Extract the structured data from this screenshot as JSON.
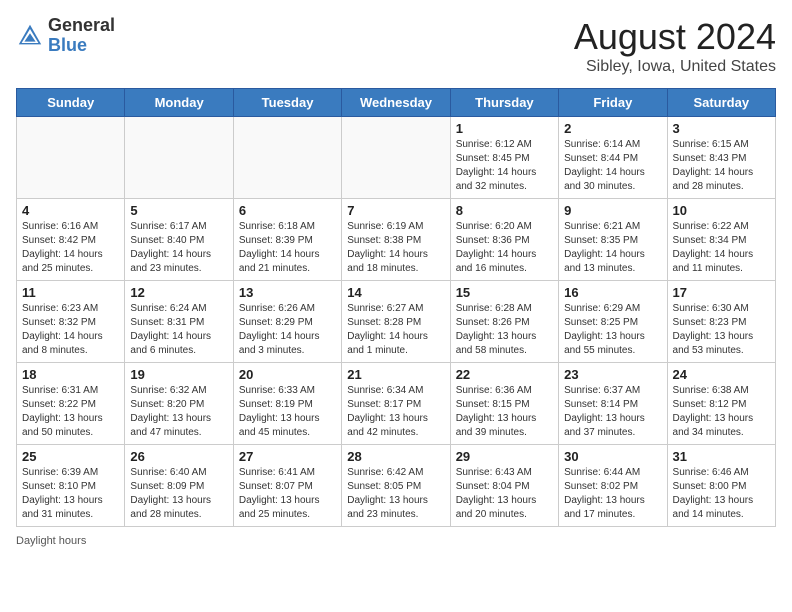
{
  "header": {
    "logo_general": "General",
    "logo_blue": "Blue",
    "month_year": "August 2024",
    "location": "Sibley, Iowa, United States"
  },
  "days_of_week": [
    "Sunday",
    "Monday",
    "Tuesday",
    "Wednesday",
    "Thursday",
    "Friday",
    "Saturday"
  ],
  "footer": {
    "daylight_label": "Daylight hours"
  },
  "weeks": [
    [
      {
        "day": "",
        "info": ""
      },
      {
        "day": "",
        "info": ""
      },
      {
        "day": "",
        "info": ""
      },
      {
        "day": "",
        "info": ""
      },
      {
        "day": "1",
        "info": "Sunrise: 6:12 AM\nSunset: 8:45 PM\nDaylight: 14 hours\nand 32 minutes."
      },
      {
        "day": "2",
        "info": "Sunrise: 6:14 AM\nSunset: 8:44 PM\nDaylight: 14 hours\nand 30 minutes."
      },
      {
        "day": "3",
        "info": "Sunrise: 6:15 AM\nSunset: 8:43 PM\nDaylight: 14 hours\nand 28 minutes."
      }
    ],
    [
      {
        "day": "4",
        "info": "Sunrise: 6:16 AM\nSunset: 8:42 PM\nDaylight: 14 hours\nand 25 minutes."
      },
      {
        "day": "5",
        "info": "Sunrise: 6:17 AM\nSunset: 8:40 PM\nDaylight: 14 hours\nand 23 minutes."
      },
      {
        "day": "6",
        "info": "Sunrise: 6:18 AM\nSunset: 8:39 PM\nDaylight: 14 hours\nand 21 minutes."
      },
      {
        "day": "7",
        "info": "Sunrise: 6:19 AM\nSunset: 8:38 PM\nDaylight: 14 hours\nand 18 minutes."
      },
      {
        "day": "8",
        "info": "Sunrise: 6:20 AM\nSunset: 8:36 PM\nDaylight: 14 hours\nand 16 minutes."
      },
      {
        "day": "9",
        "info": "Sunrise: 6:21 AM\nSunset: 8:35 PM\nDaylight: 14 hours\nand 13 minutes."
      },
      {
        "day": "10",
        "info": "Sunrise: 6:22 AM\nSunset: 8:34 PM\nDaylight: 14 hours\nand 11 minutes."
      }
    ],
    [
      {
        "day": "11",
        "info": "Sunrise: 6:23 AM\nSunset: 8:32 PM\nDaylight: 14 hours\nand 8 minutes."
      },
      {
        "day": "12",
        "info": "Sunrise: 6:24 AM\nSunset: 8:31 PM\nDaylight: 14 hours\nand 6 minutes."
      },
      {
        "day": "13",
        "info": "Sunrise: 6:26 AM\nSunset: 8:29 PM\nDaylight: 14 hours\nand 3 minutes."
      },
      {
        "day": "14",
        "info": "Sunrise: 6:27 AM\nSunset: 8:28 PM\nDaylight: 14 hours\nand 1 minute."
      },
      {
        "day": "15",
        "info": "Sunrise: 6:28 AM\nSunset: 8:26 PM\nDaylight: 13 hours\nand 58 minutes."
      },
      {
        "day": "16",
        "info": "Sunrise: 6:29 AM\nSunset: 8:25 PM\nDaylight: 13 hours\nand 55 minutes."
      },
      {
        "day": "17",
        "info": "Sunrise: 6:30 AM\nSunset: 8:23 PM\nDaylight: 13 hours\nand 53 minutes."
      }
    ],
    [
      {
        "day": "18",
        "info": "Sunrise: 6:31 AM\nSunset: 8:22 PM\nDaylight: 13 hours\nand 50 minutes."
      },
      {
        "day": "19",
        "info": "Sunrise: 6:32 AM\nSunset: 8:20 PM\nDaylight: 13 hours\nand 47 minutes."
      },
      {
        "day": "20",
        "info": "Sunrise: 6:33 AM\nSunset: 8:19 PM\nDaylight: 13 hours\nand 45 minutes."
      },
      {
        "day": "21",
        "info": "Sunrise: 6:34 AM\nSunset: 8:17 PM\nDaylight: 13 hours\nand 42 minutes."
      },
      {
        "day": "22",
        "info": "Sunrise: 6:36 AM\nSunset: 8:15 PM\nDaylight: 13 hours\nand 39 minutes."
      },
      {
        "day": "23",
        "info": "Sunrise: 6:37 AM\nSunset: 8:14 PM\nDaylight: 13 hours\nand 37 minutes."
      },
      {
        "day": "24",
        "info": "Sunrise: 6:38 AM\nSunset: 8:12 PM\nDaylight: 13 hours\nand 34 minutes."
      }
    ],
    [
      {
        "day": "25",
        "info": "Sunrise: 6:39 AM\nSunset: 8:10 PM\nDaylight: 13 hours\nand 31 minutes."
      },
      {
        "day": "26",
        "info": "Sunrise: 6:40 AM\nSunset: 8:09 PM\nDaylight: 13 hours\nand 28 minutes."
      },
      {
        "day": "27",
        "info": "Sunrise: 6:41 AM\nSunset: 8:07 PM\nDaylight: 13 hours\nand 25 minutes."
      },
      {
        "day": "28",
        "info": "Sunrise: 6:42 AM\nSunset: 8:05 PM\nDaylight: 13 hours\nand 23 minutes."
      },
      {
        "day": "29",
        "info": "Sunrise: 6:43 AM\nSunset: 8:04 PM\nDaylight: 13 hours\nand 20 minutes."
      },
      {
        "day": "30",
        "info": "Sunrise: 6:44 AM\nSunset: 8:02 PM\nDaylight: 13 hours\nand 17 minutes."
      },
      {
        "day": "31",
        "info": "Sunrise: 6:46 AM\nSunset: 8:00 PM\nDaylight: 13 hours\nand 14 minutes."
      }
    ]
  ]
}
